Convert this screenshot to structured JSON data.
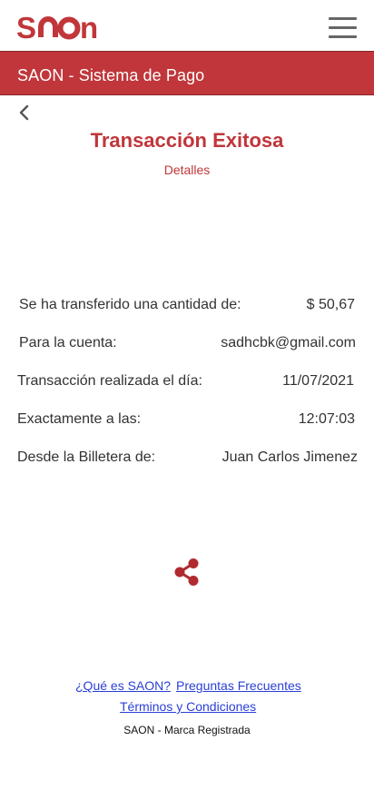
{
  "header": {
    "logo_text": "SAON",
    "logo_icon": "saon-logo",
    "menu_icon": "hamburger-menu-icon"
  },
  "banner": {
    "title": "SAON - Sistema de Pago"
  },
  "page": {
    "back_icon": "chevron-left-icon",
    "title": "Transacción Exitosa",
    "subtitle": "Detalles"
  },
  "details": {
    "amount_label": "Se ha transferido una cantidad de:",
    "amount_value": "$ 50,67",
    "account_label": "Para la cuenta:",
    "account_value": "sadhcbk@gmail.com",
    "date_label": "Transacción realizada el día:",
    "date_value": "11/07/2021",
    "time_label": "Exactamente a las:",
    "time_value": "12:07:03",
    "wallet_label": "Desde la Billetera de:",
    "wallet_value": "Juan Carlos Jimenez"
  },
  "share": {
    "icon": "share-icon"
  },
  "footer": {
    "link_about": "¿Qué es SAON?",
    "link_faq": "Preguntas Frecuentes",
    "link_terms": "Términos y Condiciones",
    "trademark": "SAON - Marca Registrada"
  },
  "colors": {
    "brand_red": "#c0363a",
    "link_blue": "#2a3fd6",
    "menu_gray": "#666666"
  }
}
